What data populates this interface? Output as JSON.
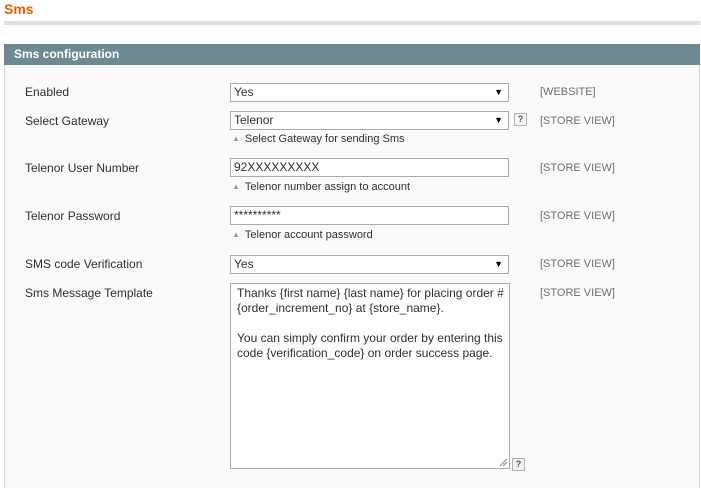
{
  "page": {
    "title": "Sms"
  },
  "section": {
    "title": "Sms configuration"
  },
  "fields": {
    "enabled": {
      "label": "Enabled",
      "value": "Yes",
      "scope": "[WEBSITE]"
    },
    "gateway": {
      "label": "Select Gateway",
      "value": "Telenor",
      "hint": "Select Gateway for sending Sms",
      "scope": "[STORE VIEW]",
      "help": "?"
    },
    "user_number": {
      "label": "Telenor User Number",
      "value": "92XXXXXXXXX",
      "hint": "Telenor number assign to account",
      "scope": "[STORE VIEW]"
    },
    "password": {
      "label": "Telenor Password",
      "value": "**********",
      "hint": "Telenor account password",
      "scope": "[STORE VIEW]"
    },
    "verification": {
      "label": "SMS code Verification",
      "value": "Yes",
      "scope": "[STORE VIEW]"
    },
    "template": {
      "label": "Sms Message Template",
      "value": "Thanks {first name} {last name} for placing order # {order_increment_no} at {store_name}.\n\nYou can simply confirm your order by entering this code {verification_code} on order success page.",
      "scope": "[STORE VIEW]",
      "help": "?"
    }
  },
  "icons": {
    "select_arrow": "▼",
    "hint_marker": "▲"
  },
  "colors": {
    "title": "#eb5e00",
    "section_header_bg": "#6f8992",
    "scope_text": "#6f6f6f"
  }
}
